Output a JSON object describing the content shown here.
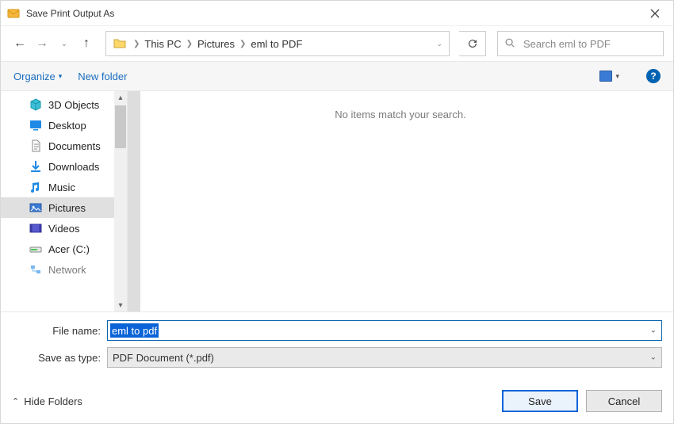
{
  "title": "Save Print Output As",
  "nav": {
    "breadcrumb": [
      "This PC",
      "Pictures",
      "eml to PDF"
    ],
    "search_placeholder": "Search eml to PDF"
  },
  "toolbar": {
    "organize": "Organize",
    "new_folder": "New folder",
    "help": "?"
  },
  "sidebar": {
    "items": [
      {
        "label": "3D Objects",
        "icon": "cube"
      },
      {
        "label": "Desktop",
        "icon": "desktop"
      },
      {
        "label": "Documents",
        "icon": "document"
      },
      {
        "label": "Downloads",
        "icon": "download"
      },
      {
        "label": "Music",
        "icon": "music"
      },
      {
        "label": "Pictures",
        "icon": "pictures",
        "selected": true
      },
      {
        "label": "Videos",
        "icon": "video"
      },
      {
        "label": "Acer (C:)",
        "icon": "drive"
      },
      {
        "label": "Network",
        "icon": "network"
      }
    ]
  },
  "main": {
    "empty_message": "No items match your search."
  },
  "form": {
    "file_name_label": "File name:",
    "file_name_value": "eml to pdf",
    "save_type_label": "Save as type:",
    "save_type_value": "PDF Document (*.pdf)"
  },
  "footer": {
    "hide_folders": "Hide Folders",
    "save": "Save",
    "cancel": "Cancel"
  }
}
